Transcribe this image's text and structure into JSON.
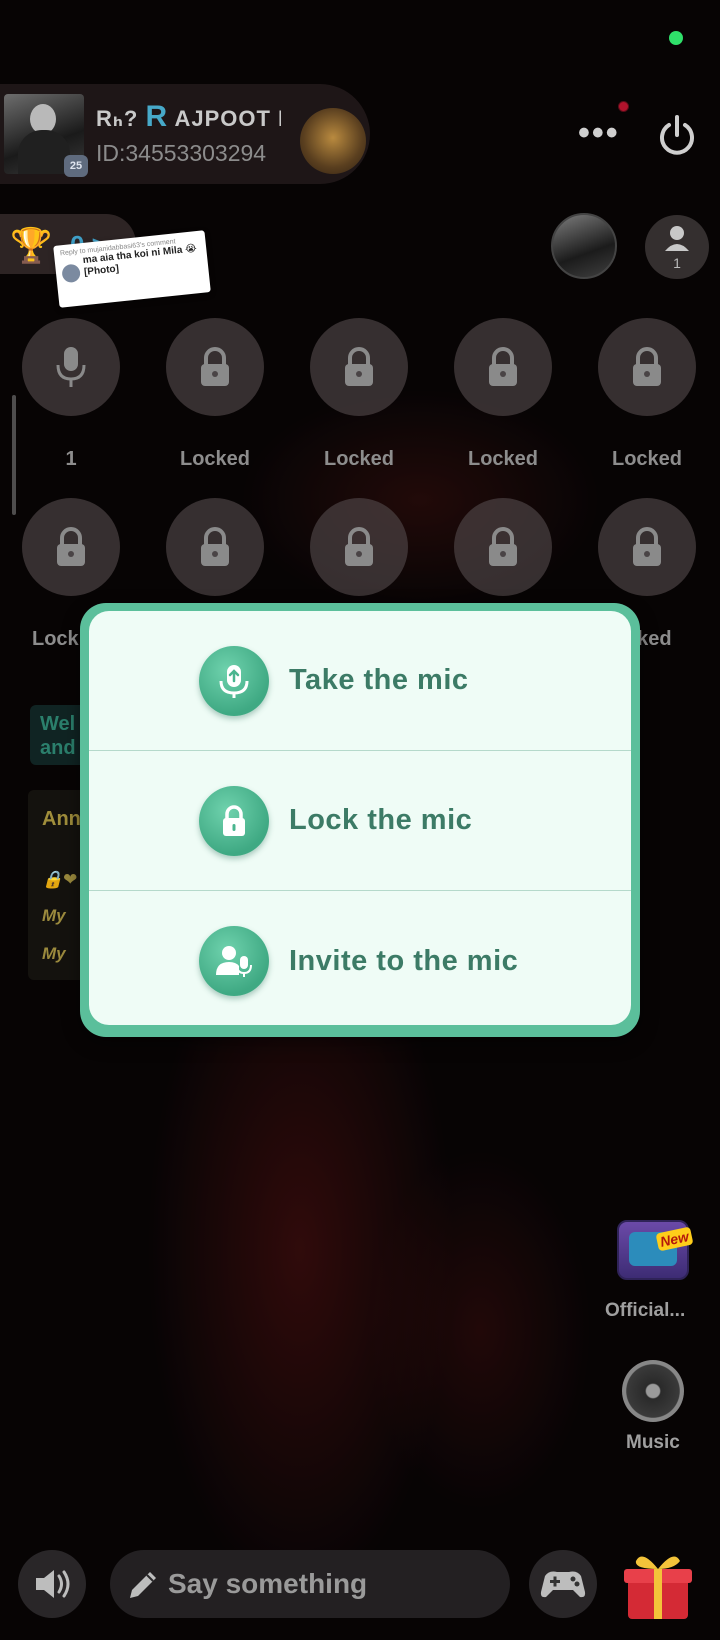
{
  "header": {
    "room_name_prefix": "Rₕ?",
    "room_name_accent": "R",
    "room_name_rest": "AJPOOT I",
    "room_id": "ID:34553303294",
    "avatar_level": "25"
  },
  "leaderboard": {
    "count": "0 >"
  },
  "comment": {
    "reply_to": "Reply to mujanidabbasi63's comment",
    "text": "ma aia tha koi ni Mila 😭 [Photo]"
  },
  "viewers": {
    "count": "1"
  },
  "mic_seats": {
    "row1": [
      "1",
      "Locked",
      "Locked",
      "Locked",
      "Locked"
    ],
    "row2": [
      "Lock",
      "",
      "",
      "",
      "cked"
    ]
  },
  "chat": {
    "welcome": "Wel\nand",
    "announcement_label": "Ann",
    "line1": "🔒❤",
    "line2": "My",
    "line3": "My"
  },
  "popup": {
    "take_mic": "Take the mic",
    "lock_mic": "Lock the mic",
    "invite_mic": "Invite to the mic"
  },
  "side": {
    "official_label": "Official...",
    "official_badge": "New",
    "music_label": "Music"
  },
  "bottom": {
    "say_placeholder": "Say something"
  },
  "colors": {
    "popup_frame": "#5bbf9b",
    "popup_bg": "#effcf6",
    "popup_text": "#3c7b66",
    "status_dot": "#2fe06a"
  }
}
